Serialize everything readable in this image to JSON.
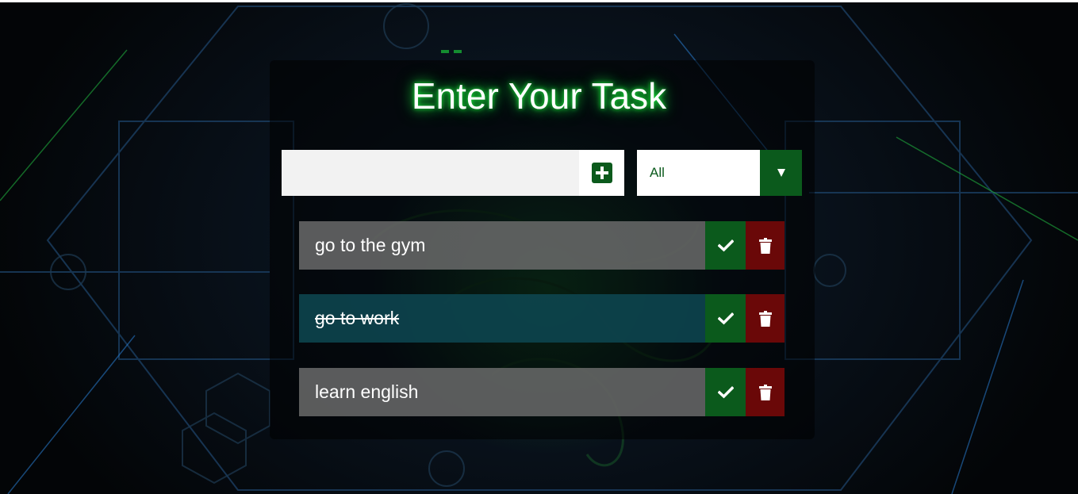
{
  "colors": {
    "accent_green": "#0b5a1c",
    "delete_red": "#6a0808",
    "title_glow": "#19e63a",
    "todo_bg": "#6e6e6e",
    "completed_bg": "#0e4852"
  },
  "header": {
    "title": "Enter Your Task"
  },
  "form": {
    "input_value": "",
    "add_icon": "plus-square-icon",
    "filter": {
      "selected": "All",
      "arrow_icon": "caret-down-icon"
    }
  },
  "todos": [
    {
      "text": "go to the gym",
      "completed": false,
      "check_icon": "check-icon",
      "delete_icon": "trash-icon"
    },
    {
      "text": "go to work",
      "completed": true,
      "check_icon": "check-icon",
      "delete_icon": "trash-icon"
    },
    {
      "text": "learn english",
      "completed": false,
      "check_icon": "check-icon",
      "delete_icon": "trash-icon"
    }
  ]
}
